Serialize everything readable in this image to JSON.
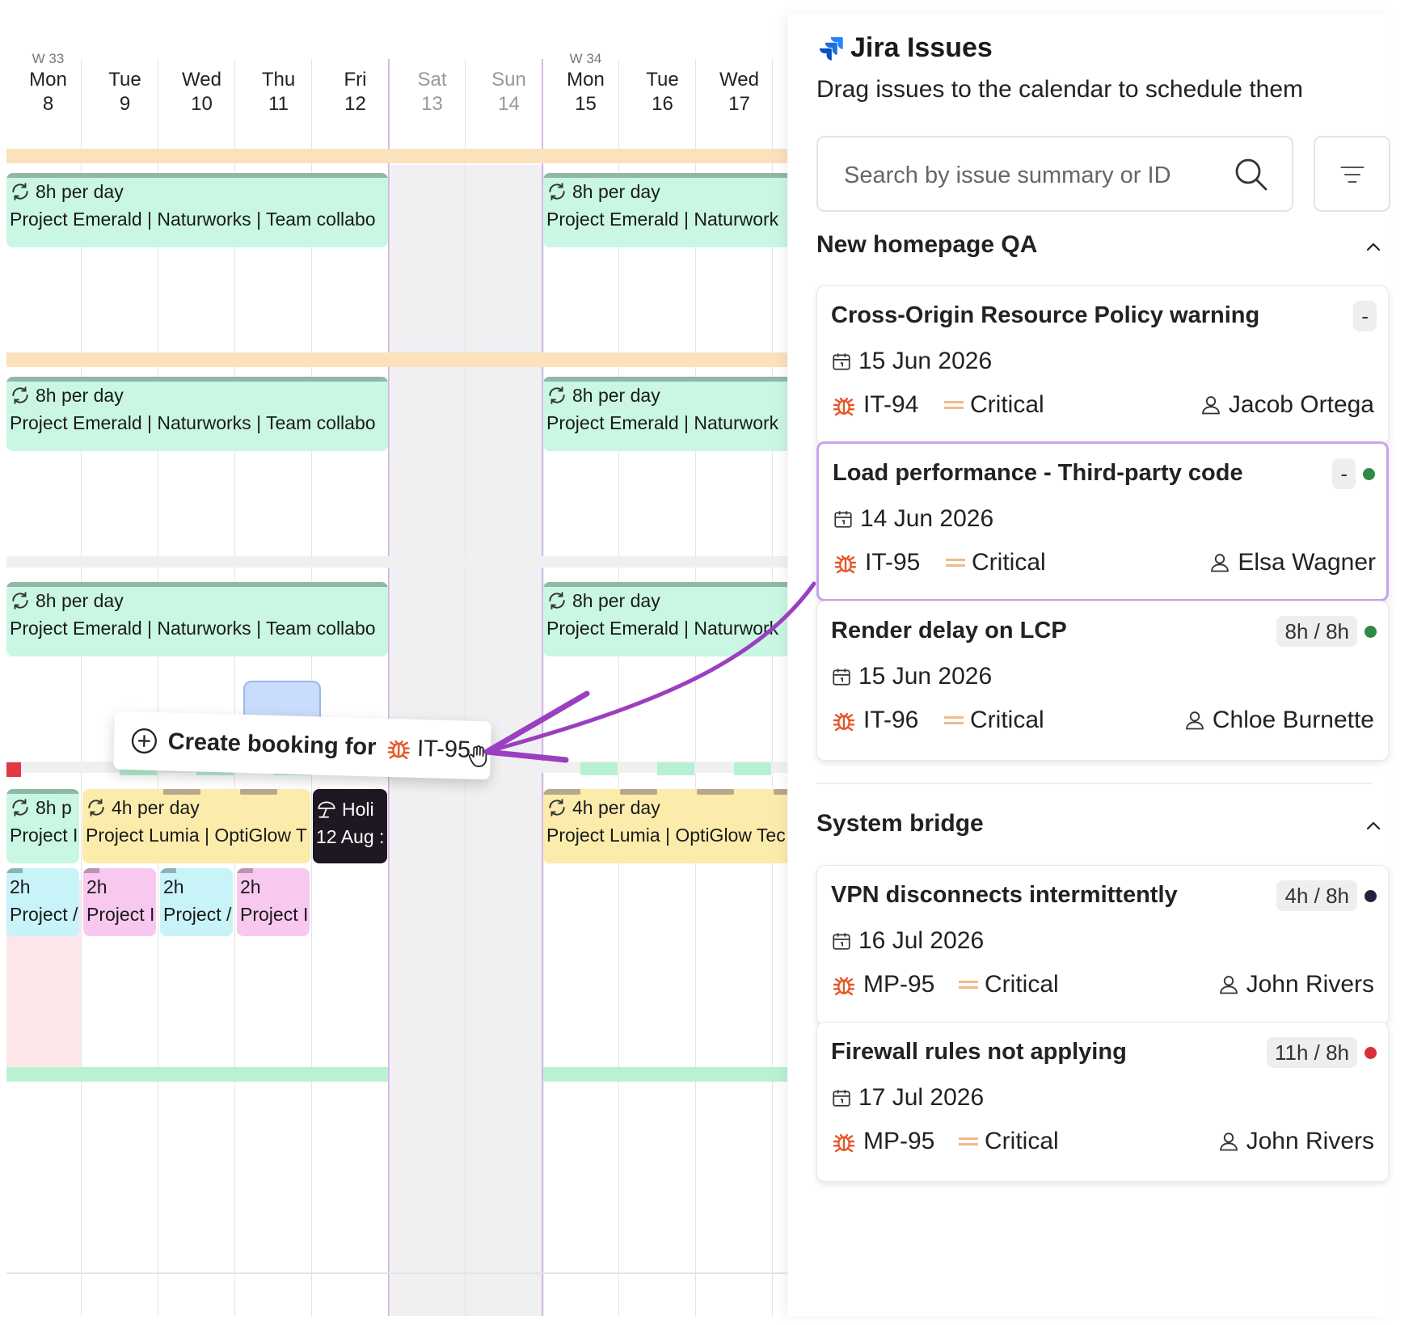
{
  "calendar": {
    "days": [
      {
        "week": "W 33",
        "name": "Mon",
        "num": "8"
      },
      {
        "week": "",
        "name": "Tue",
        "num": "9"
      },
      {
        "week": "",
        "name": "Wed",
        "num": "10"
      },
      {
        "week": "",
        "name": "Thu",
        "num": "11"
      },
      {
        "week": "",
        "name": "Fri",
        "num": "12"
      },
      {
        "week": "",
        "name": "Sat",
        "num": "13"
      },
      {
        "week": "",
        "name": "Sun",
        "num": "14"
      },
      {
        "week": "W 34",
        "name": "Mon",
        "num": "15"
      },
      {
        "week": "",
        "name": "Tue",
        "num": "16"
      },
      {
        "week": "",
        "name": "Wed",
        "num": "17"
      }
    ],
    "bookings": {
      "eight_per_day": "8h per day",
      "emerald_long": "Project Emerald | Naturworks | Team collabo",
      "emerald_short": "Project Emerald | Naturwork",
      "eight_short": "8h p",
      "project_trunc": "Project I",
      "four_per_day": "4h per day",
      "lumia_long": "Project Lumia | OptiGlow T",
      "lumia_short": "Project Lumia | OptiGlow Tec",
      "two_h": "2h",
      "proj_a": "Project /",
      "proj_b": "Project I",
      "holiday": "Holi",
      "holiday_date": "12 Aug :"
    },
    "drag_tooltip": {
      "label": "Create booking for",
      "issue_key": "IT-95"
    }
  },
  "panel": {
    "title": "Jira Issues",
    "subtitle": "Drag issues to the calendar to schedule them",
    "search": {
      "placeholder": "Search by issue summary or ID",
      "value": ""
    },
    "groups": [
      {
        "name": "New homepage QA",
        "issues": [
          {
            "title": "Cross-Origin Resource Policy warning",
            "badge": "-",
            "dot": "",
            "date": "15 Jun 2026",
            "key": "IT-94",
            "priority": "Critical",
            "assignee": "Jacob Ortega"
          },
          {
            "title": "Load performance - Third-party code",
            "badge": "-",
            "dot": "#2f8a4a",
            "date": "14 Jun 2026",
            "key": "IT-95",
            "priority": "Critical",
            "assignee": "Elsa Wagner"
          },
          {
            "title": "Render delay on LCP",
            "badge": "8h / 8h",
            "dot": "#2f8a4a",
            "date": "15 Jun 2026",
            "key": "IT-96",
            "priority": "Critical",
            "assignee": "Chloe Burnette"
          }
        ]
      },
      {
        "name": "System bridge",
        "issues": [
          {
            "title": "VPN disconnects intermittently",
            "badge": "4h / 8h",
            "dot": "#2a1f3d",
            "date": "16 Jul 2026",
            "key": "MP-95",
            "priority": "Critical",
            "assignee": "John Rivers"
          },
          {
            "title": "Firewall rules not applying",
            "badge": "11h / 8h",
            "dot": "#d9303b",
            "date": "17 Jul 2026",
            "key": "MP-95",
            "priority": "Critical",
            "assignee": "John Rivers"
          }
        ]
      }
    ]
  },
  "colors": {
    "accent_purple": "#9b3fc0",
    "bug_red": "#e8562a",
    "jira_blue": "#2684ff"
  }
}
